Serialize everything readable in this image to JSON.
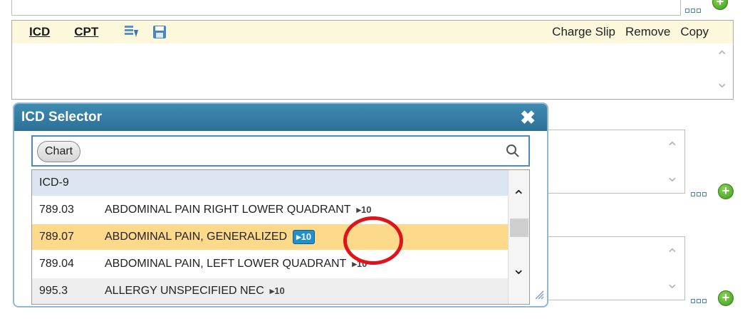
{
  "toolbar": {
    "tabs": [
      "ICD",
      "CPT"
    ],
    "actions": [
      "Charge Slip",
      "Remove",
      "Copy"
    ]
  },
  "selector": {
    "title": "ICD Selector",
    "chip": "Chart",
    "group_header": "ICD-9",
    "rows": [
      {
        "code": "789.03",
        "desc": "ABDOMINAL PAIN RIGHT LOWER QUADRANT",
        "tag": "▸10"
      },
      {
        "code": "789.07",
        "desc": "ABDOMINAL PAIN, GENERALIZED",
        "tag": "▸10",
        "selected": true
      },
      {
        "code": "789.04",
        "desc": "ABDOMINAL PAIN, LEFT LOWER QUADRANT",
        "tag": "▸10"
      },
      {
        "code": "995.3",
        "desc": "ALLERGY UNSPECIFIED NEC",
        "tag": "▸10"
      }
    ]
  },
  "colors": {
    "header_blue": "#2d7096",
    "selected_row": "#fdd98a",
    "toolbar_bg": "#fbf8dc",
    "highlight_ring": "#e0131a"
  },
  "icons": [
    "expand-list-icon",
    "save-icon",
    "close-icon",
    "search-icon",
    "add-icon",
    "more-icon",
    "resize-grip-icon"
  ]
}
